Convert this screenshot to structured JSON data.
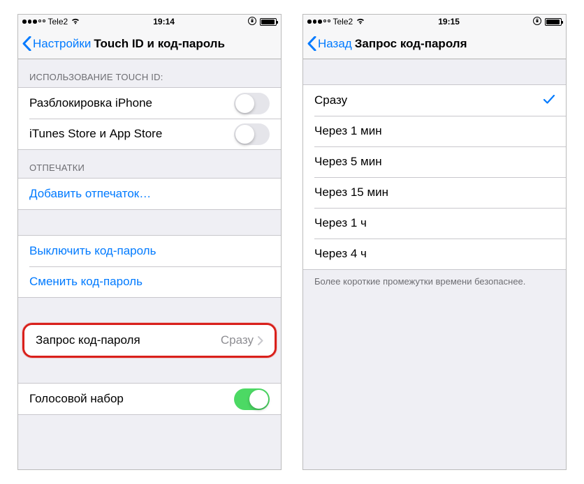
{
  "left": {
    "status": {
      "carrier": "Tele2",
      "time": "19:14",
      "battery_pct": 88
    },
    "nav": {
      "back": "Настройки",
      "title": "Touch ID и код-пароль"
    },
    "section_touchid_header": "ИСПОЛЬЗОВАНИЕ TOUCH ID:",
    "unlock_iphone": {
      "label": "Разблокировка iPhone",
      "on": false
    },
    "itunes_store": {
      "label": "iTunes Store и App Store",
      "on": false
    },
    "section_fingerprints_header": "ОТПЕЧАТКИ",
    "add_fingerprint": "Добавить отпечаток…",
    "disable_passcode": "Выключить код-пароль",
    "change_passcode": "Сменить код-пароль",
    "require_passcode": {
      "label": "Запрос код-пароля",
      "value": "Сразу"
    },
    "voice_dial": {
      "label": "Голосовой набор",
      "on": true
    }
  },
  "right": {
    "status": {
      "carrier": "Tele2",
      "time": "19:15",
      "battery_pct": 88
    },
    "nav": {
      "back": "Назад",
      "title": "Запрос код-пароля"
    },
    "options": [
      {
        "label": "Сразу",
        "selected": true
      },
      {
        "label": "Через 1 мин",
        "selected": false
      },
      {
        "label": "Через 5 мин",
        "selected": false
      },
      {
        "label": "Через 15 мин",
        "selected": false
      },
      {
        "label": "Через 1 ч",
        "selected": false
      },
      {
        "label": "Через 4 ч",
        "selected": false
      }
    ],
    "footer": "Более короткие промежутки времени безопаснее."
  }
}
